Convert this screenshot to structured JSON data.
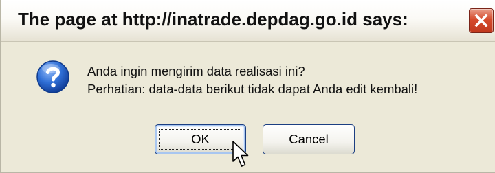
{
  "dialog": {
    "title": "The page at http://inatrade.depdag.go.id says:",
    "message_line1": "Anda ingin mengirim data realisasi ini?",
    "message_line2": "Perhatian: data-data berikut tidak dapat Anda edit kembali!",
    "ok_label": "OK",
    "cancel_label": "Cancel"
  },
  "icons": {
    "close": "close-icon",
    "message": "question-icon",
    "pointer": "mouse-cursor-icon"
  },
  "colors": {
    "dialog_background": "#ece9d8",
    "close_button": "#d64b2c",
    "question_icon": "#1d5bc4",
    "button_border": "#1c3f82"
  }
}
